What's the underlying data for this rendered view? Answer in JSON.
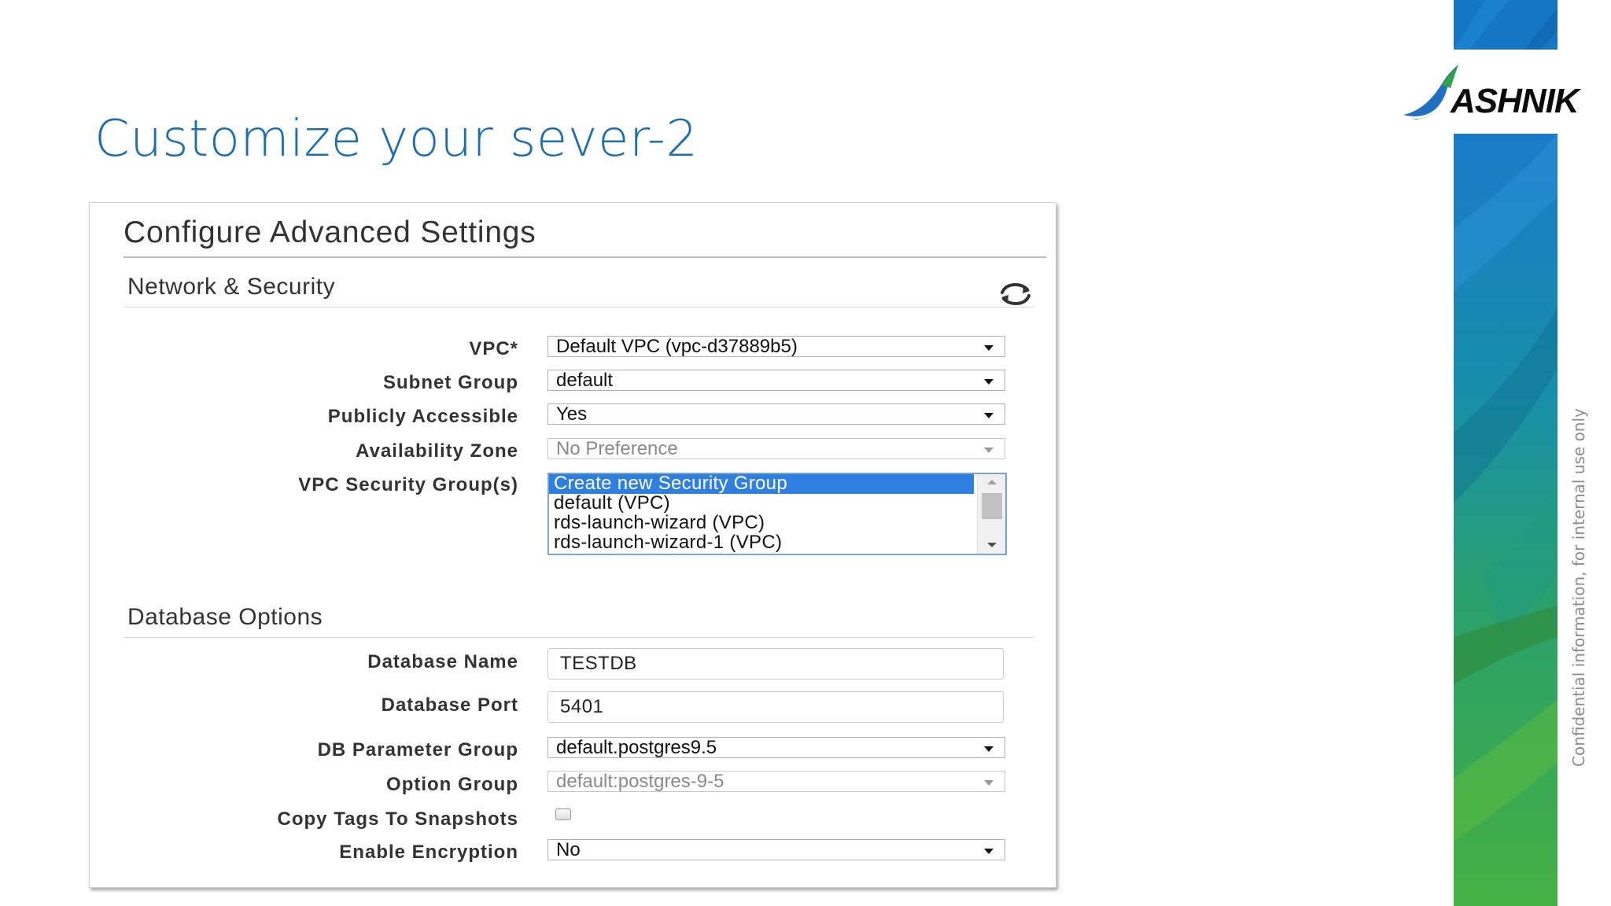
{
  "slide": {
    "title": "Customize your sever-2",
    "logo_text": "ASHNIK",
    "confidential_note": "Confidential information, for internal use only"
  },
  "panel": {
    "title": "Configure Advanced Settings",
    "network_security": {
      "heading": "Network & Security",
      "fields": {
        "vpc": {
          "label": "VPC*",
          "value": "Default VPC (vpc-d37889b5)"
        },
        "subnet_group": {
          "label": "Subnet Group",
          "value": "default"
        },
        "publicly_accessible": {
          "label": "Publicly Accessible",
          "value": "Yes"
        },
        "availability_zone": {
          "label": "Availability Zone",
          "value": "No Preference"
        },
        "security_groups": {
          "label": "VPC Security Group(s)",
          "options": [
            "Create new Security Group",
            "default (VPC)",
            "rds-launch-wizard (VPC)",
            "rds-launch-wizard-1 (VPC)"
          ],
          "selected": "Create new Security Group"
        }
      }
    },
    "database_options": {
      "heading": "Database Options",
      "fields": {
        "database_name": {
          "label": "Database Name",
          "value": "TESTDB"
        },
        "database_port": {
          "label": "Database Port",
          "value": "5401"
        },
        "db_parameter_group": {
          "label": "DB Parameter Group",
          "value": "default.postgres9.5"
        },
        "option_group": {
          "label": "Option Group",
          "value": "default:postgres-9-5"
        },
        "copy_tags": {
          "label": "Copy Tags To Snapshots",
          "checked": false
        },
        "enable_encryption": {
          "label": "Enable Encryption",
          "value": "No"
        }
      }
    }
  },
  "icons": {
    "refresh": "refresh-icon",
    "dropdown": "chevron-down-icon",
    "logo": "ashnik-logo-icon"
  },
  "colors": {
    "title_blue": "#1f6fb0",
    "selection_blue": "#2f7fe0",
    "strip_blue": "#1577c4",
    "strip_green": "#3aa548"
  }
}
